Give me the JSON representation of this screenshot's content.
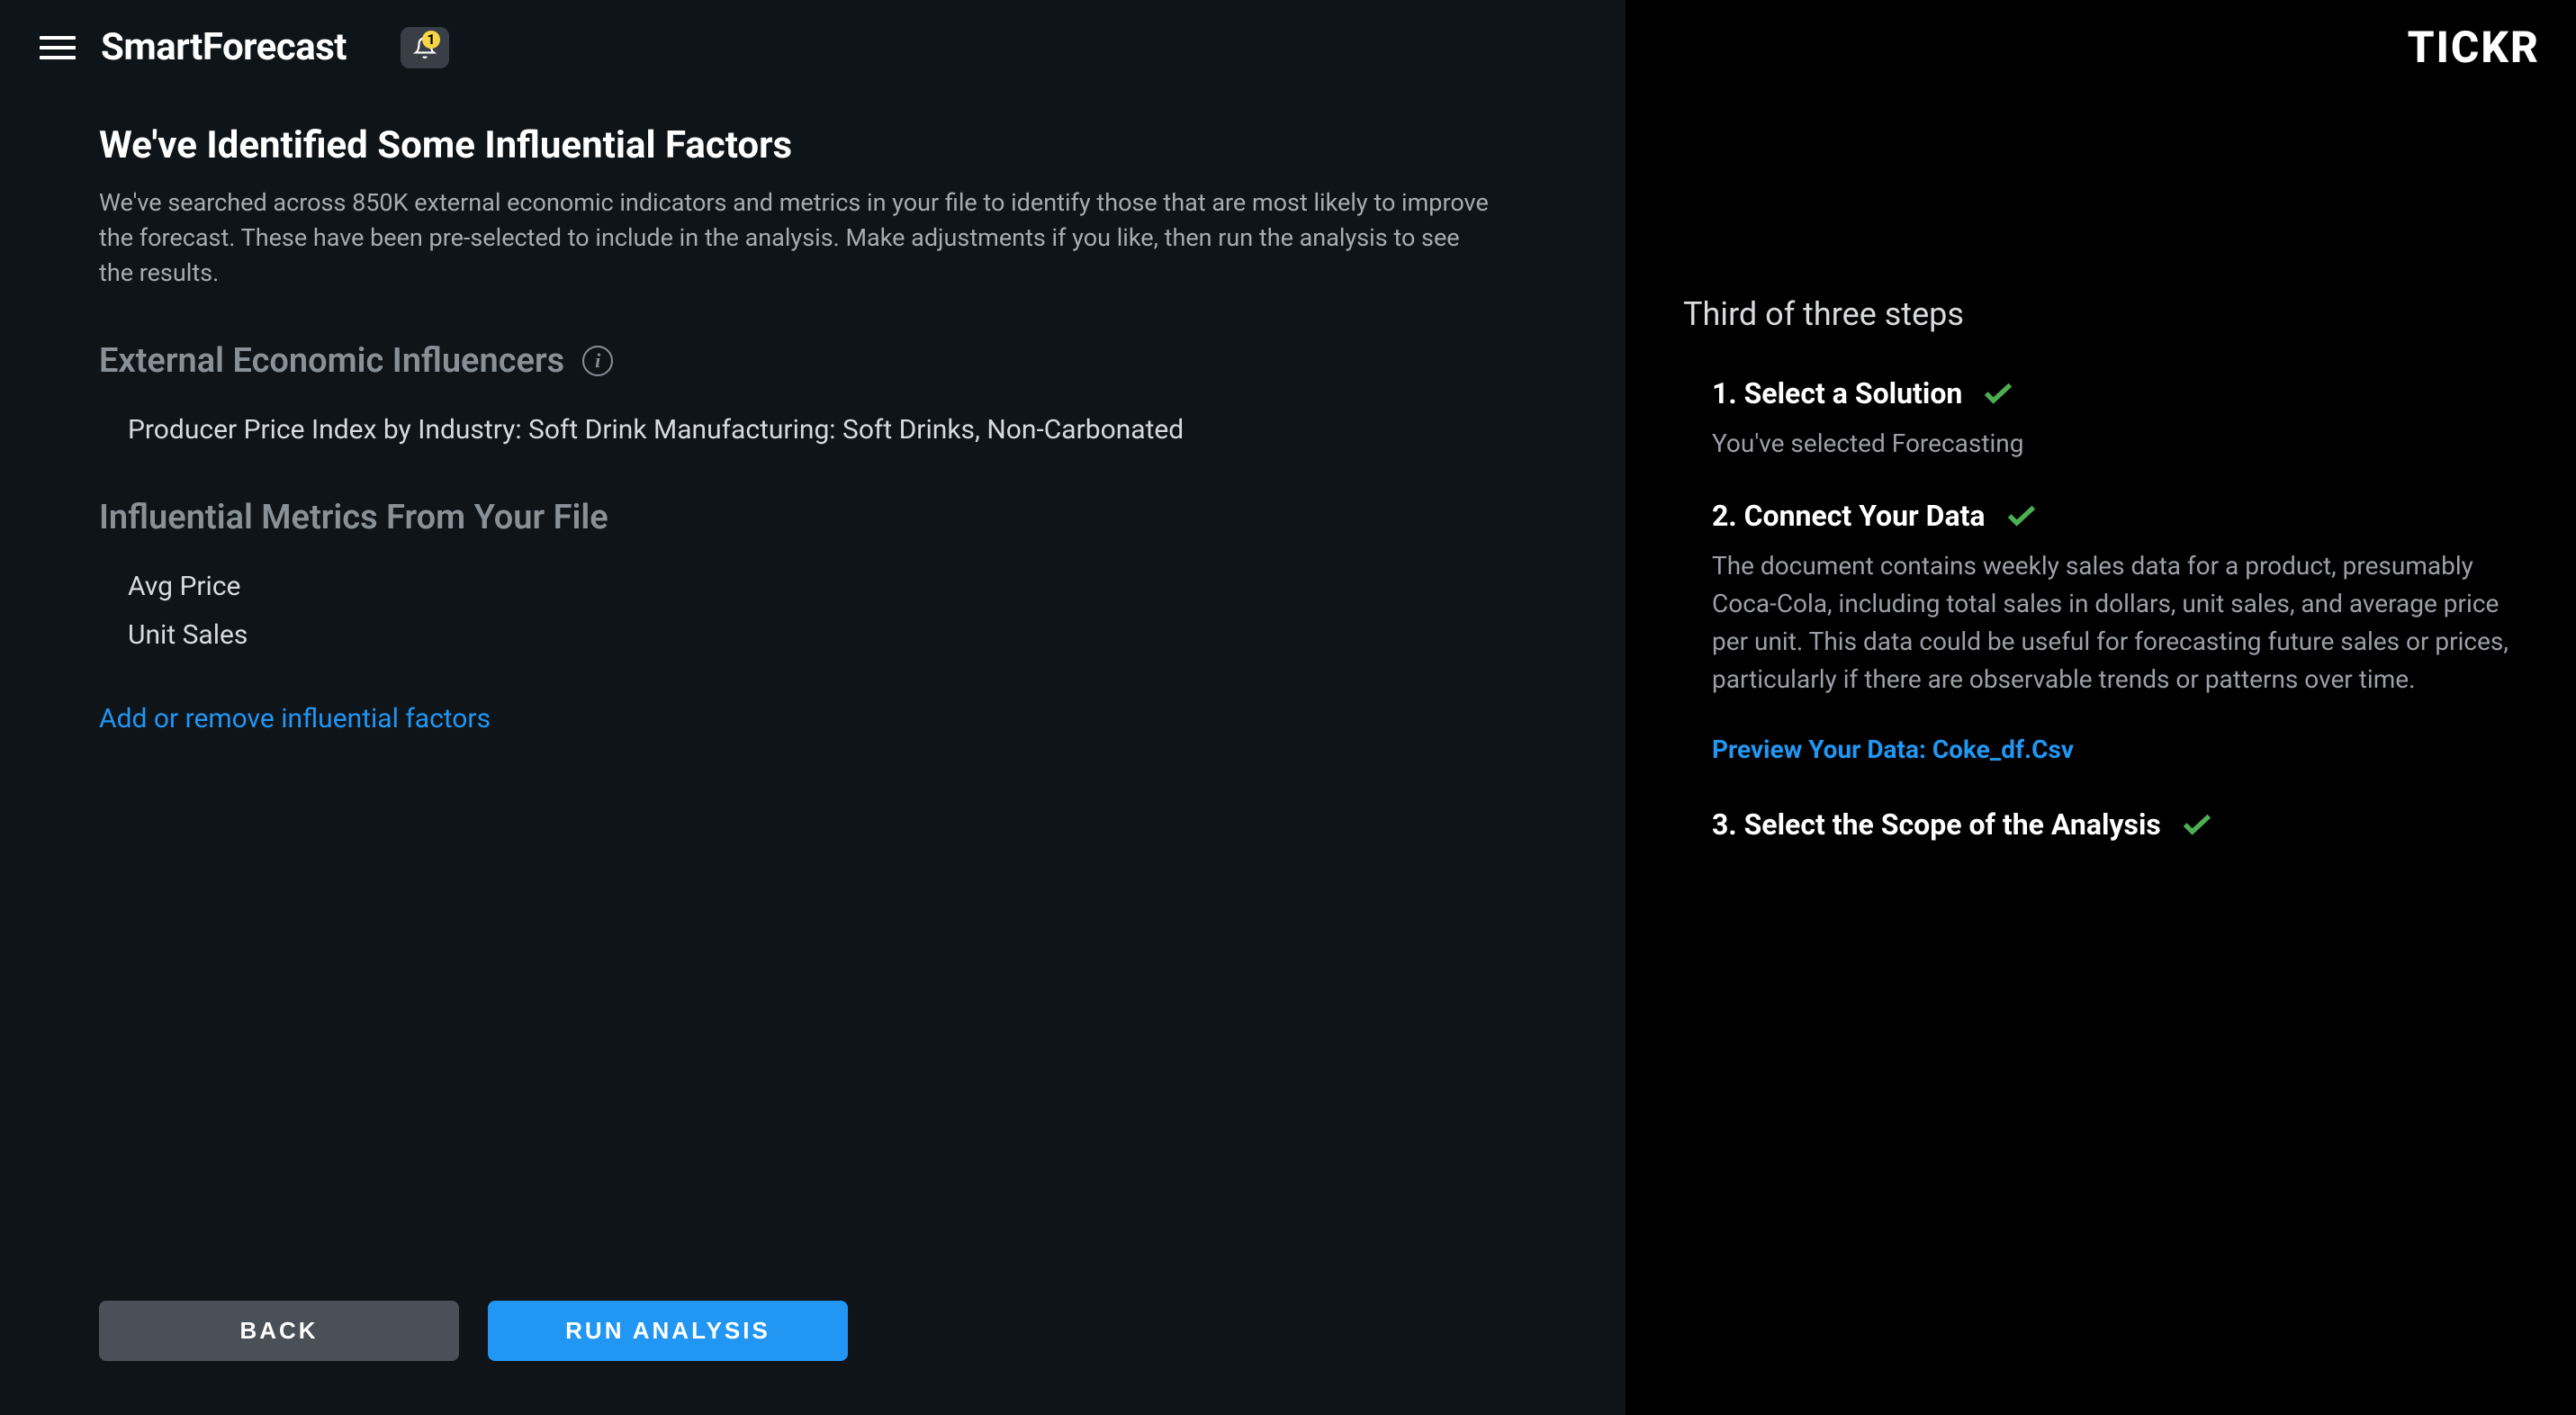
{
  "header": {
    "app_title": "SmartForecast",
    "notification_count": "1"
  },
  "main": {
    "page_title": "We've Identified Some Influential Factors",
    "page_description": "We've searched across 850K external economic indicators and metrics in your file to identify those that are most likely to improve the forecast. These have been pre-selected to include in the analysis. Make adjustments if you like, then run the analysis to see the results.",
    "section_external": {
      "title": "External Economic Influencers",
      "items": [
        "Producer Price Index by Industry: Soft Drink Manufacturing: Soft Drinks, Non-Carbonated"
      ]
    },
    "section_file": {
      "title": "Influential Metrics From Your File",
      "items": [
        "Avg Price",
        "Unit Sales"
      ]
    },
    "link_add_remove": "Add or remove influential factors",
    "btn_back": "BACK",
    "btn_run": "RUN ANALYSIS"
  },
  "sidebar": {
    "brand": "TICKR",
    "steps_header": "Third of three steps",
    "steps": [
      {
        "title": "1. Select a Solution",
        "description": "You've selected Forecasting",
        "completed": true
      },
      {
        "title": "2. Connect Your Data",
        "description": "The document contains weekly sales data for a product, presumably Coca-Cola, including total sales in dollars, unit sales, and average price per unit. This data could be useful for forecasting future sales or prices, particularly if there are observable trends or patterns over time.",
        "completed": true
      },
      {
        "title": "3. Select the Scope of the Analysis",
        "description": "",
        "completed": true
      }
    ],
    "preview_link": "Preview Your Data: Coke_df.Csv"
  }
}
